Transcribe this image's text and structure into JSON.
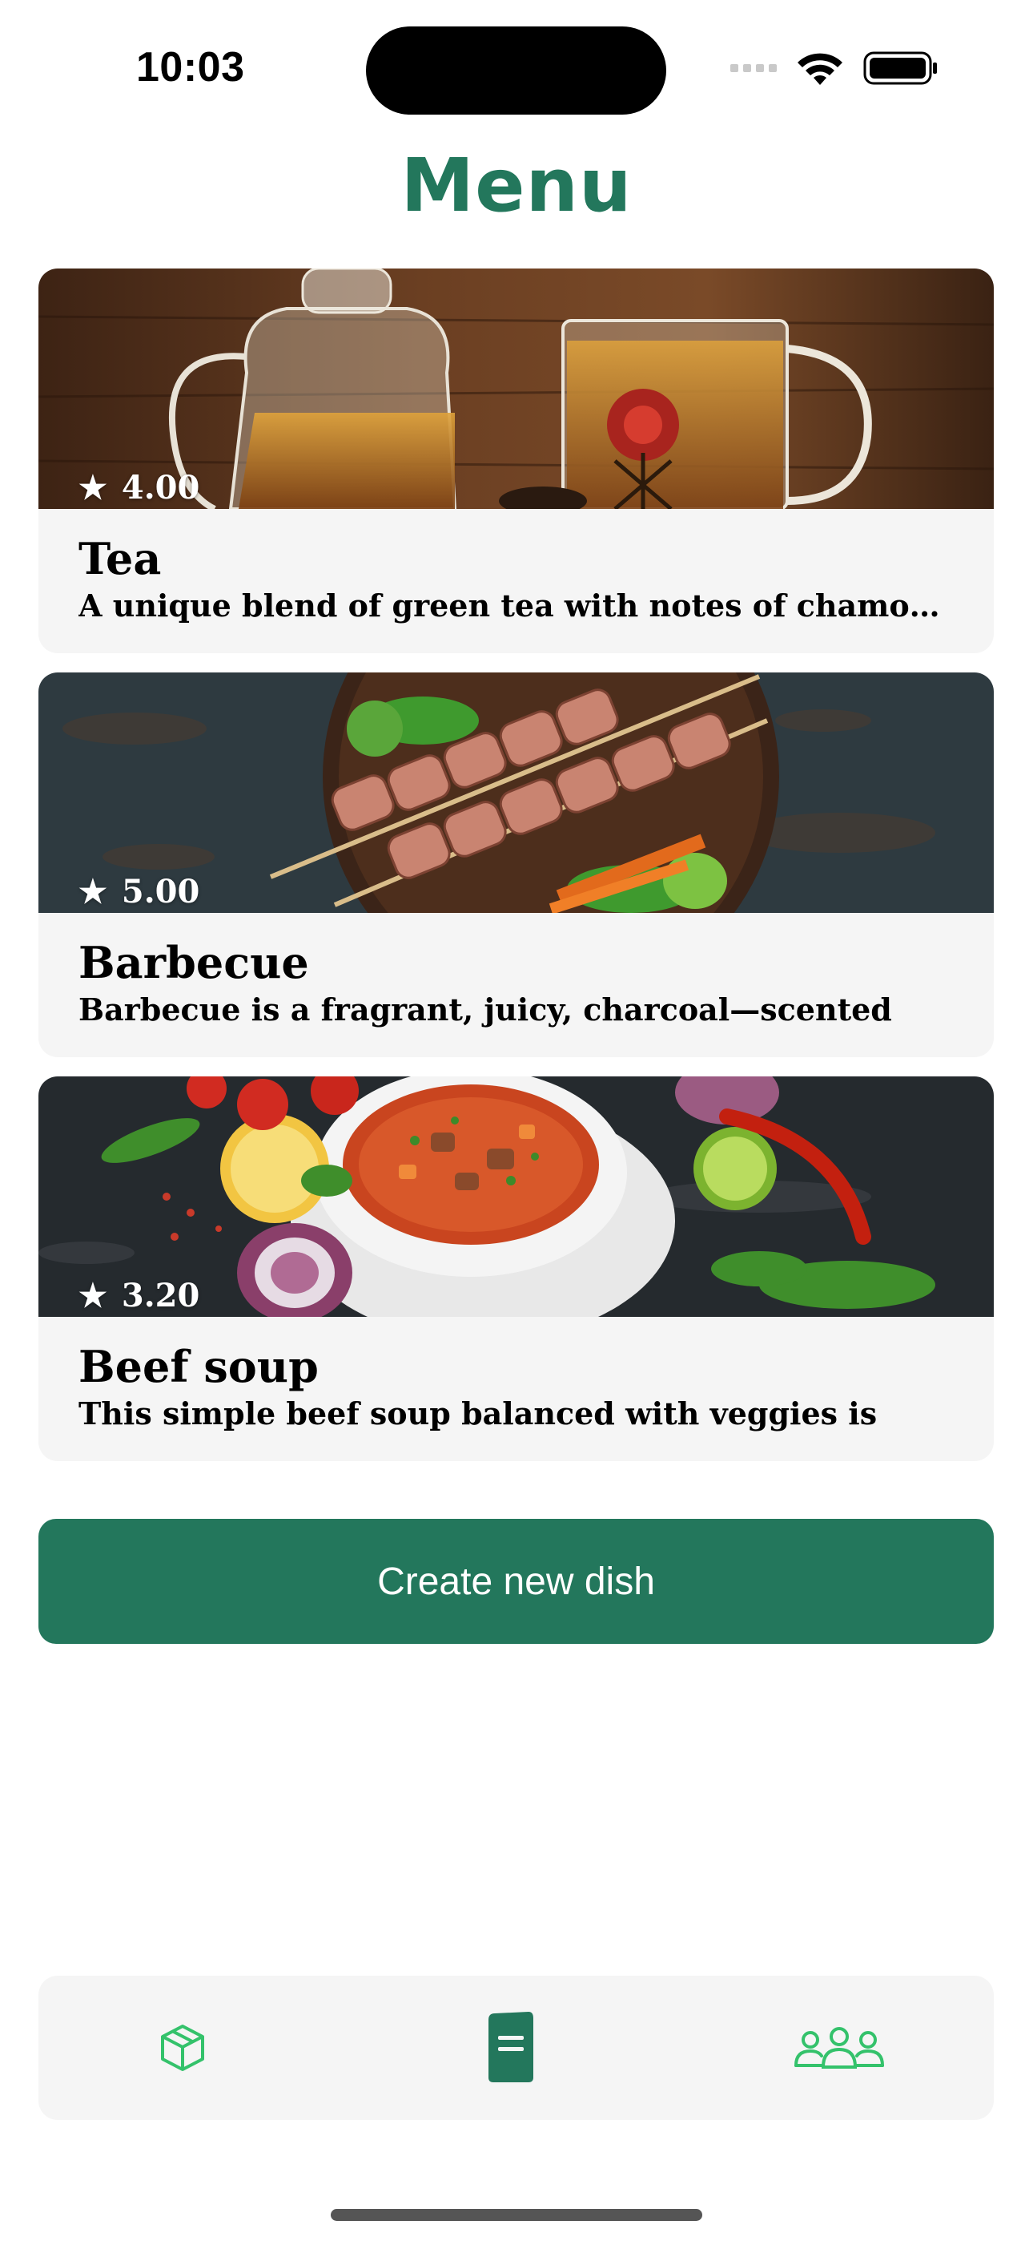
{
  "status_bar": {
    "time": "10:03"
  },
  "page": {
    "title": "Menu"
  },
  "dishes": [
    {
      "name": "Tea",
      "rating": "4.00",
      "description": "A unique blend of green tea with notes of chamomile"
    },
    {
      "name": "Barbecue",
      "rating": "5.00",
      "description": "Barbecue is a fragrant, juicy, charcoal—scented"
    },
    {
      "name": "Beef soup",
      "rating": "3.20",
      "description": "This simple beef soup balanced with veggies is"
    }
  ],
  "actions": {
    "create_label": "Create new dish"
  },
  "tab_bar": {
    "items": [
      {
        "icon": "cube-icon",
        "active": false
      },
      {
        "icon": "book-icon",
        "active": true
      },
      {
        "icon": "people-icon",
        "active": false
      }
    ]
  },
  "colors": {
    "accent": "#23775c",
    "tab_inactive": "#34c26b",
    "card_bg": "#f5f5f5"
  }
}
